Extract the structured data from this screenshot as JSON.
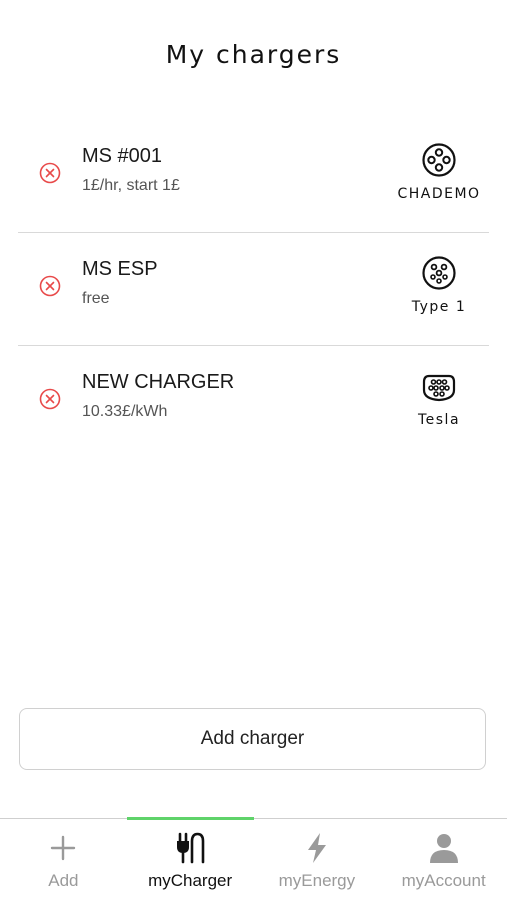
{
  "header": {
    "title": "My chargers"
  },
  "chargers": [
    {
      "name": "MS #001",
      "price": "1£/hr, start 1£",
      "connector": "CHADEMO",
      "connector_icon": "chademo-connector-icon"
    },
    {
      "name": "MS ESP",
      "price": "free",
      "connector": "Type 1",
      "connector_icon": "type1-connector-icon"
    },
    {
      "name": "NEW CHARGER",
      "price": "10.33£/kWh",
      "connector": "Tesla",
      "connector_icon": "tesla-connector-icon"
    }
  ],
  "actions": {
    "add_charger_label": "Add charger"
  },
  "bottom_nav": {
    "items": [
      {
        "label": "Add",
        "icon": "plus-icon",
        "active": false
      },
      {
        "label": "myCharger",
        "icon": "plug-icon",
        "active": true
      },
      {
        "label": "myEnergy",
        "icon": "lightning-icon",
        "active": false
      },
      {
        "label": "myAccount",
        "icon": "user-icon",
        "active": false
      }
    ]
  },
  "colors": {
    "remove_icon": "#e84a4a",
    "active_tab_indicator": "#5fd36a",
    "inactive_nav": "#9a9a9a"
  }
}
